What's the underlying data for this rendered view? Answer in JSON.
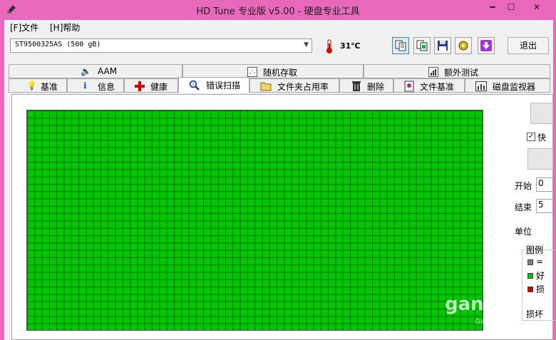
{
  "window": {
    "title": "HD Tune 专业版 v5.00 - 硬盘专业工具",
    "minimize": "━",
    "maximize": "☐",
    "close": "✕"
  },
  "menu": [
    "[F]文件",
    "[H]帮助"
  ],
  "toolbar": {
    "drive": "ST9500325AS (500 gB)",
    "temperature": "31℃",
    "exit_label": "退出"
  },
  "tabs_top": [
    {
      "label": "AAM",
      "icon": "speaker-icon"
    },
    {
      "label": "随机存取",
      "icon": "random-access-icon"
    },
    {
      "label": "额外测试",
      "icon": "extra-tests-icon"
    }
  ],
  "tabs_bottom": [
    {
      "label": "基准",
      "icon": "lightbulb-icon"
    },
    {
      "label": "信息",
      "icon": "info-icon"
    },
    {
      "label": "健康",
      "icon": "health-cross-icon"
    },
    {
      "label": "错误扫描",
      "icon": "magnifier-icon",
      "active": true
    },
    {
      "label": "文件夹占用率",
      "icon": "folder-icon"
    },
    {
      "label": "删除",
      "icon": "trash-icon"
    },
    {
      "label": "文件基准",
      "icon": "file-benchmark-icon"
    },
    {
      "label": "磁盘监视器",
      "icon": "disk-monitor-icon"
    }
  ],
  "scan": {
    "block_color": "#00c800",
    "grid_line_color": "#006b00"
  },
  "side": {
    "checkbox_label": "快",
    "start_label": "开始",
    "start_value": "0",
    "end_label": "结束",
    "end_value": "5",
    "unit_label": "单位",
    "legend_title": "图例",
    "legend": [
      {
        "color": "#808080",
        "label": "="
      },
      {
        "color": "#00c800",
        "label": "好"
      },
      {
        "color": "#cc0000",
        "label": "损"
      }
    ],
    "damaged_label": "损坏"
  },
  "watermark": {
    "main": "gan",
    "sub": "Ganji.com"
  }
}
